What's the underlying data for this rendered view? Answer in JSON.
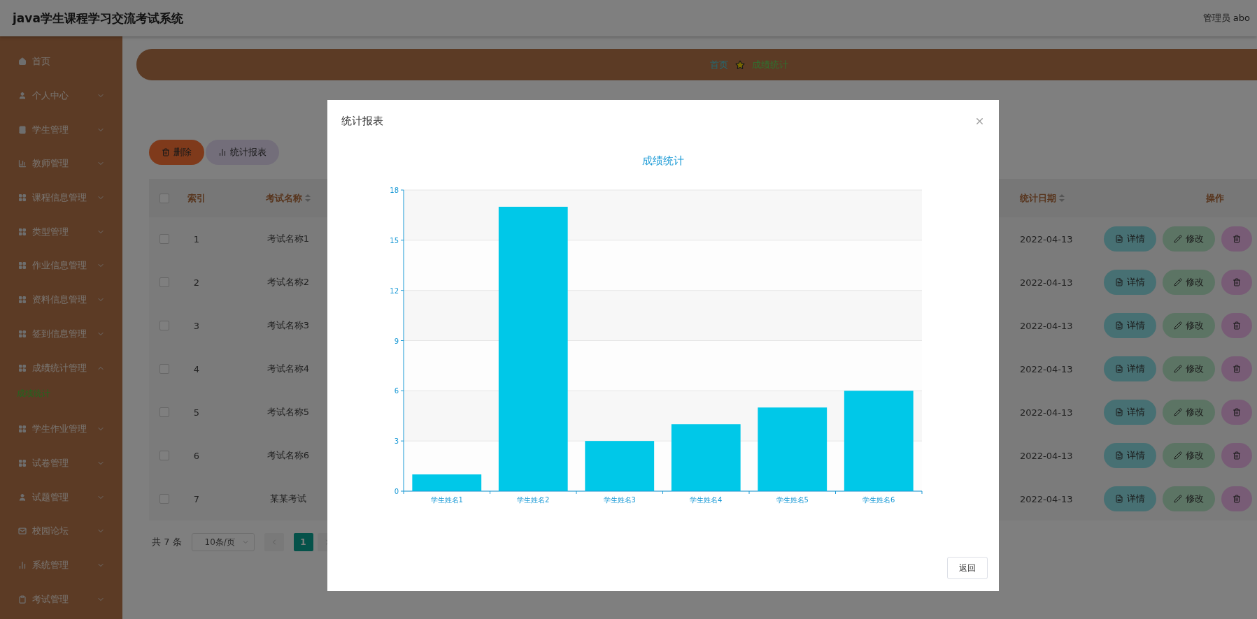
{
  "header": {
    "title": "java学生课程学习交流考试系统",
    "user": "管理员 abo"
  },
  "sidebar": {
    "items": [
      {
        "label": "首页",
        "kind": "link"
      },
      {
        "label": "个人中心",
        "kind": "menu",
        "expanded": false
      },
      {
        "label": "学生管理",
        "kind": "menu",
        "expanded": false
      },
      {
        "label": "教师管理",
        "kind": "menu",
        "expanded": false
      },
      {
        "label": "课程信息管理",
        "kind": "menu",
        "expanded": false
      },
      {
        "label": "类型管理",
        "kind": "menu",
        "expanded": false
      },
      {
        "label": "作业信息管理",
        "kind": "menu",
        "expanded": false
      },
      {
        "label": "资料信息管理",
        "kind": "menu",
        "expanded": false
      },
      {
        "label": "签到信息管理",
        "kind": "menu",
        "expanded": false
      },
      {
        "label": "成绩统计管理",
        "kind": "menu",
        "expanded": true,
        "children": [
          {
            "label": "成绩统计",
            "selected": true
          }
        ]
      },
      {
        "label": "学生作业管理",
        "kind": "menu",
        "expanded": false
      },
      {
        "label": "试卷管理",
        "kind": "menu",
        "expanded": false
      },
      {
        "label": "试题管理",
        "kind": "menu",
        "expanded": false
      },
      {
        "label": "校园论坛",
        "kind": "menu",
        "expanded": false
      },
      {
        "label": "系统管理",
        "kind": "menu",
        "expanded": false
      },
      {
        "label": "考试管理",
        "kind": "menu",
        "expanded": false
      }
    ]
  },
  "breadcrumb": [
    "首页",
    "成绩统计"
  ],
  "toolbar": [
    {
      "label": "删除",
      "kind": "danger"
    },
    {
      "label": "统计报表",
      "kind": "chart"
    }
  ],
  "table": {
    "header_checked": false,
    "columns": [
      {
        "label": "索引",
        "sortable": false
      },
      {
        "label": "考试名称",
        "sortable": true
      },
      {
        "label": "统计日期",
        "sortable": true
      },
      {
        "label": "操作",
        "sortable": false
      }
    ],
    "rows": [
      {
        "checked": false,
        "index": "1",
        "exam_name": "考试名称1",
        "date": "2022-04-13",
        "actions": [
          {
            "label": "详情",
            "kind": "detail"
          },
          {
            "label": "修改",
            "kind": "edit"
          }
        ]
      },
      {
        "checked": false,
        "index": "2",
        "exam_name": "考试名称2",
        "date": "2022-04-13",
        "actions": [
          {
            "label": "详情",
            "kind": "detail"
          },
          {
            "label": "修改",
            "kind": "edit"
          }
        ]
      },
      {
        "checked": false,
        "index": "3",
        "exam_name": "考试名称3",
        "date": "2022-04-13",
        "actions": [
          {
            "label": "详情",
            "kind": "detail"
          },
          {
            "label": "修改",
            "kind": "edit"
          }
        ]
      },
      {
        "checked": false,
        "index": "4",
        "exam_name": "考试名称4",
        "date": "2022-04-13",
        "actions": [
          {
            "label": "详情",
            "kind": "detail"
          },
          {
            "label": "修改",
            "kind": "edit"
          }
        ]
      },
      {
        "checked": false,
        "index": "5",
        "exam_name": "考试名称5",
        "date": "2022-04-13",
        "actions": [
          {
            "label": "详情",
            "kind": "detail"
          },
          {
            "label": "修改",
            "kind": "edit"
          }
        ]
      },
      {
        "checked": false,
        "index": "6",
        "exam_name": "考试名称6",
        "date": "2022-04-13",
        "actions": [
          {
            "label": "详情",
            "kind": "detail"
          },
          {
            "label": "修改",
            "kind": "edit"
          }
        ]
      },
      {
        "checked": false,
        "index": "7",
        "exam_name": "某某考试",
        "date": "2022-04-13",
        "actions": [
          {
            "label": "详情",
            "kind": "detail"
          },
          {
            "label": "修改",
            "kind": "edit"
          }
        ]
      }
    ]
  },
  "pagination": {
    "total": "共 7 条",
    "page_size": "10条/页",
    "pages": [
      {
        "label": "1",
        "selected": true
      }
    ]
  },
  "modal": {
    "title": "统计报表",
    "button": "返回",
    "chart_data": {
      "type": "bar",
      "title": "成绩统计",
      "categories": [
        "学生姓名1",
        "学生姓名2",
        "学生姓名3",
        "学生姓名4",
        "学生姓名5",
        "学生姓名6"
      ],
      "series": [
        {
          "color": "#00c8e8",
          "values": [
            1,
            17,
            3,
            4,
            5,
            6
          ]
        }
      ],
      "grid": true,
      "ylim": [
        0,
        18
      ],
      "yticks": [
        0,
        3,
        6,
        9,
        12,
        15,
        18
      ]
    }
  }
}
